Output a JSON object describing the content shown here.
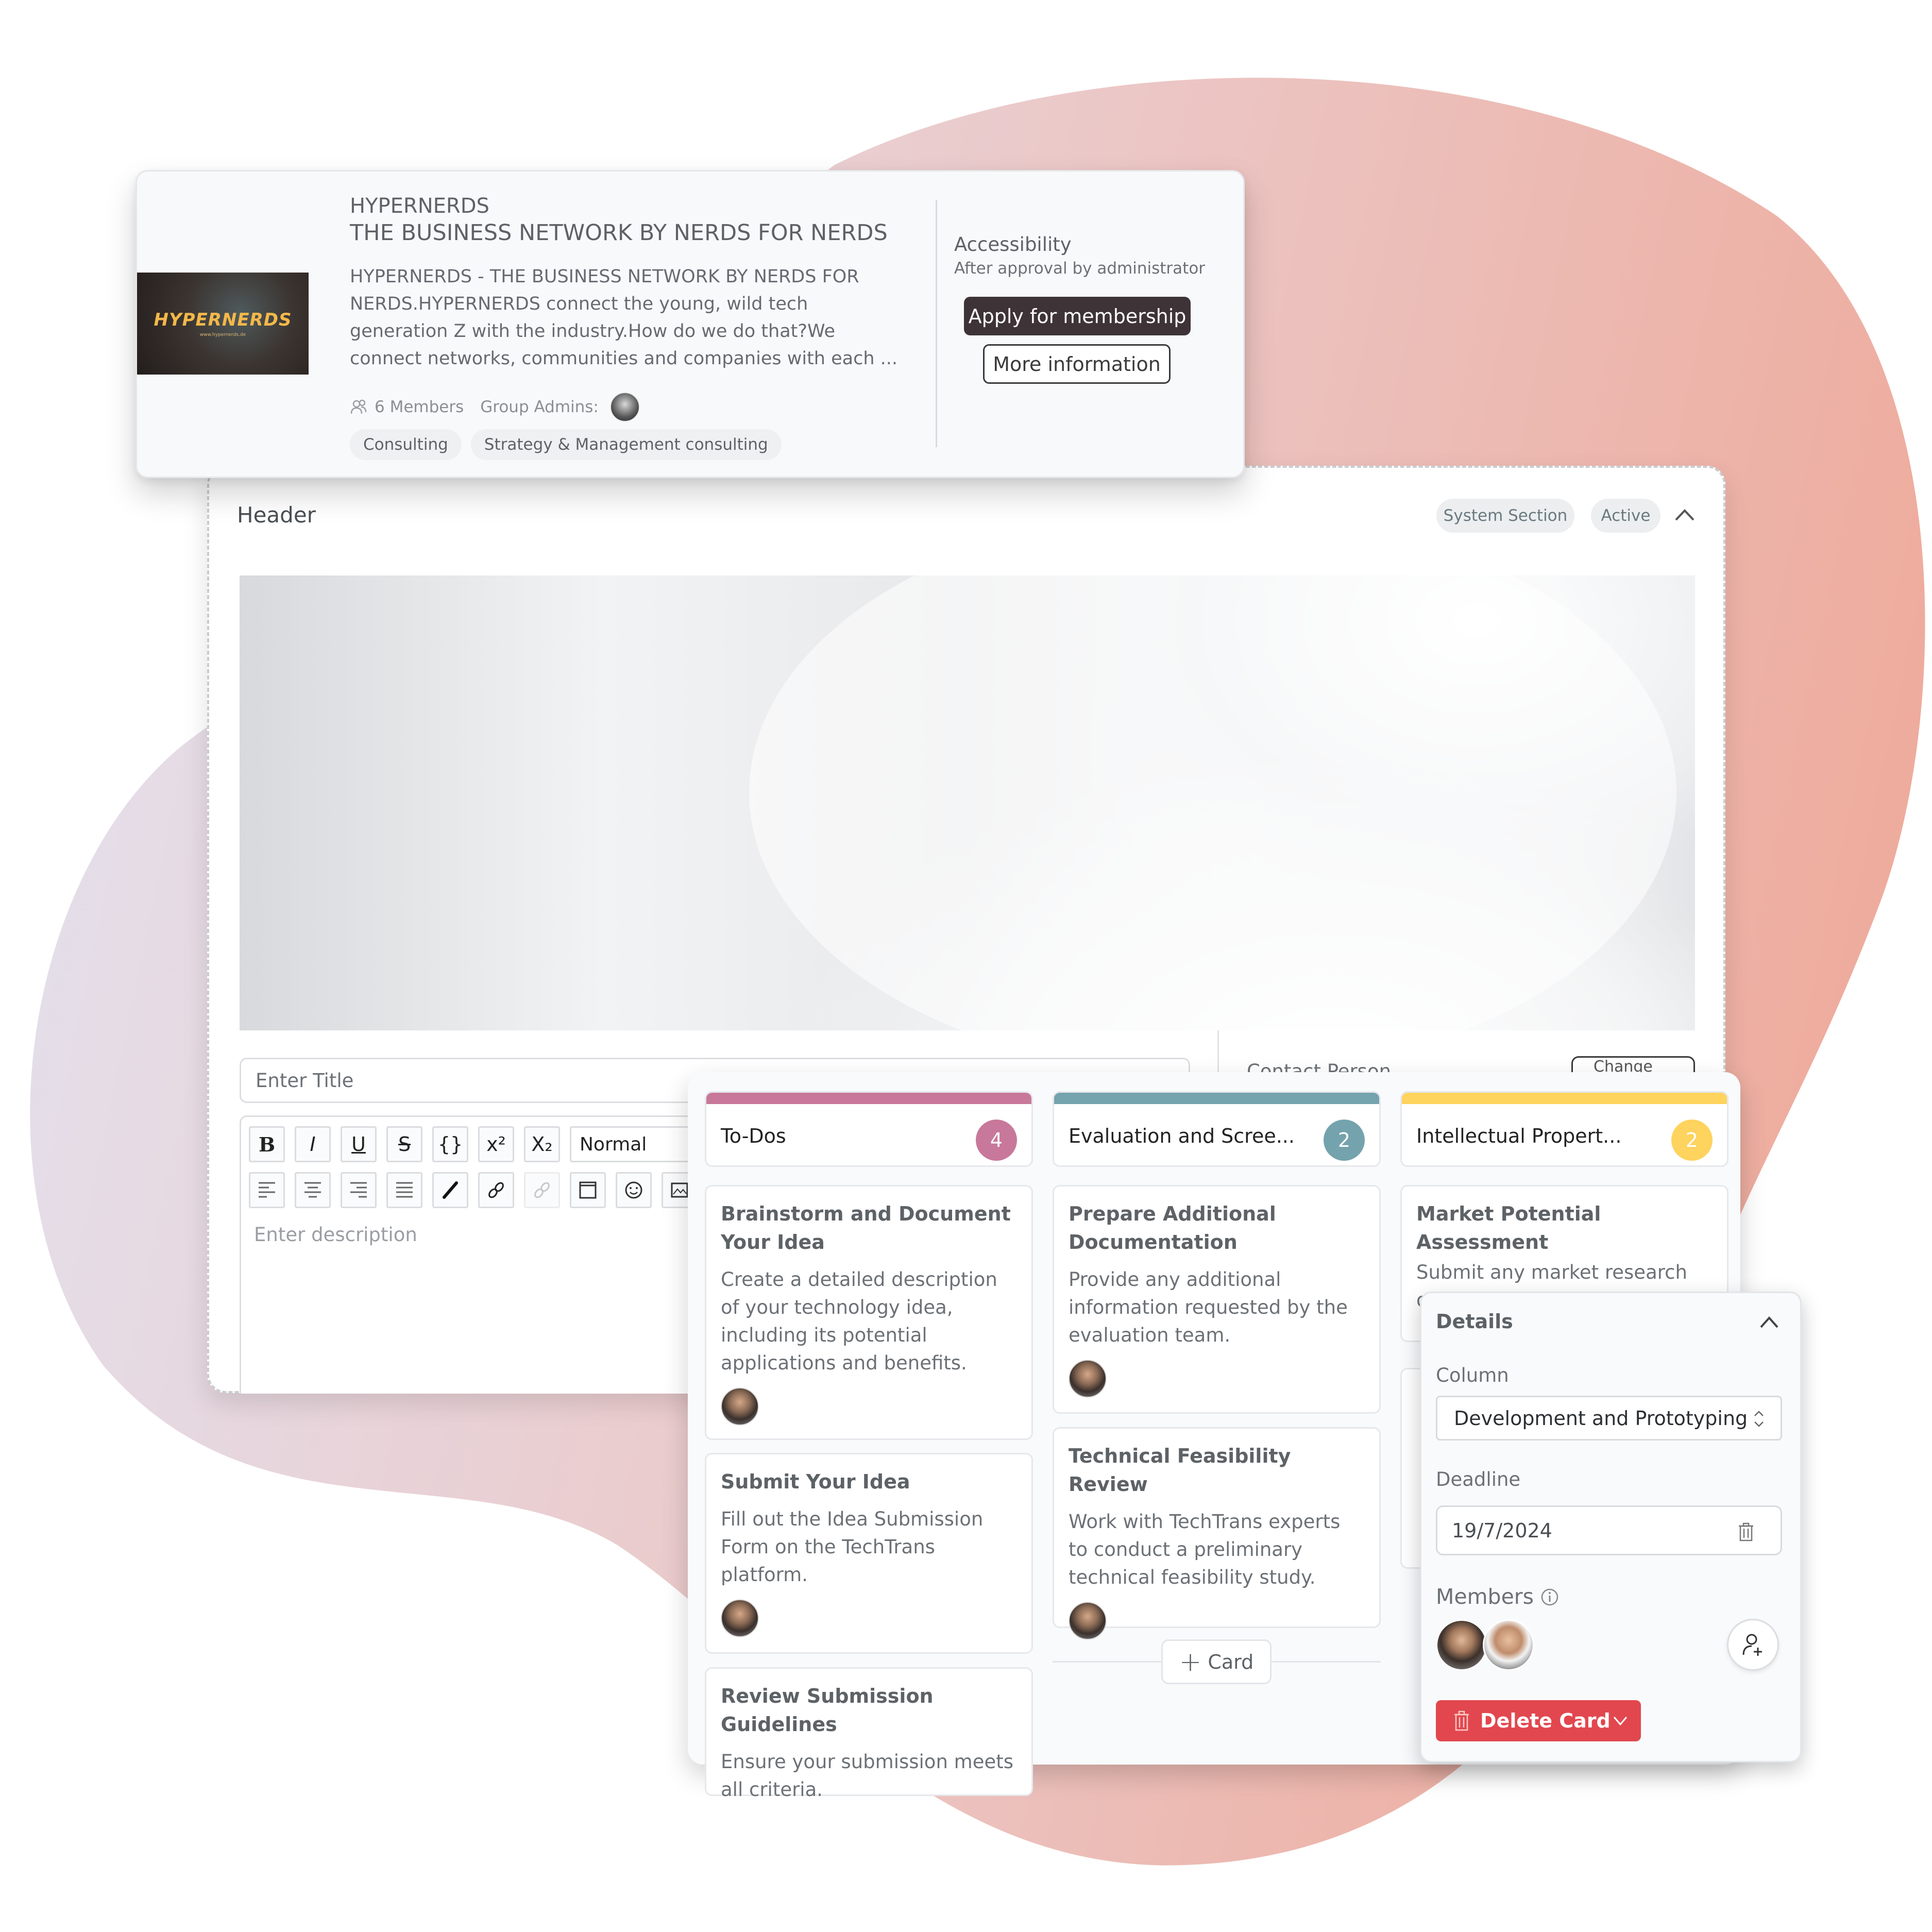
{
  "colors": {
    "blob_start": "#e6dde9",
    "blob_end": "#eeaea0",
    "todos": "#c8789a",
    "evaluation": "#74a3ad",
    "ip": "#fed35e",
    "danger": "#e2474f",
    "apply_bg": "#3e3337"
  },
  "group": {
    "logo_word": "HYPERNERDS",
    "logo_url": "www.hypernerds.de",
    "title_line1": "HYPERNERDS",
    "title_line2": "THE BUSINESS NETWORK BY NERDS FOR NERDS",
    "description": "HYPERNERDS - THE BUSINESS NETWORK BY NERDS FOR NERDS.HYPERNERDS connect the young, wild tech generation Z with the industry.How do we do that?We connect networks, communities and companies with each ...",
    "members": "6 Members",
    "admins_label": "Group Admins:",
    "tags": [
      "Consulting",
      "Strategy & Management consulting"
    ],
    "accessibility_title": "Accessibility",
    "accessibility_value": "After approval by administrator",
    "apply_label": "Apply for membership",
    "more_label": "More information"
  },
  "header_section": {
    "label": "Header",
    "badges": [
      "System Section",
      "Active"
    ],
    "title_placeholder": "Enter Title",
    "description_placeholder": "Enter description",
    "format_select": "Normal",
    "toolbar_row1": [
      {
        "name": "bold-button",
        "glyph": "B"
      },
      {
        "name": "italic-button",
        "glyph": "I"
      },
      {
        "name": "underline-button",
        "glyph": "U"
      },
      {
        "name": "strikethrough-button",
        "glyph": "S"
      },
      {
        "name": "code-button",
        "glyph": "{}"
      },
      {
        "name": "superscript-button",
        "glyph": "x²"
      },
      {
        "name": "subscript-button",
        "glyph": "X₂"
      }
    ],
    "toolbar_row2": [
      {
        "name": "align-left-button",
        "glyph": "≡"
      },
      {
        "name": "align-center-button",
        "glyph": "≡"
      },
      {
        "name": "align-right-button",
        "glyph": "≡"
      },
      {
        "name": "justify-button",
        "glyph": "≡"
      },
      {
        "name": "color-picker-button",
        "glyph": "✎"
      },
      {
        "name": "link-button",
        "glyph": "🔗"
      },
      {
        "name": "unlink-button",
        "glyph": "⛓"
      },
      {
        "name": "embed-button",
        "glyph": "▣"
      },
      {
        "name": "emoji-button",
        "glyph": "☺"
      },
      {
        "name": "image-button",
        "glyph": "▨"
      }
    ],
    "contact_label": "Contact Person",
    "contact_button": "Change"
  },
  "kanban": {
    "columns": [
      {
        "name": "To-Dos",
        "count": "4",
        "cards": [
          {
            "title": "Brainstorm and Document Your Idea",
            "desc": "Create a detailed description of your technology idea, including its potential applications and benefits."
          },
          {
            "title": "Submit Your Idea",
            "desc": "Fill out the Idea Submission Form on the TechTrans platform."
          },
          {
            "title": "Review Submission Guidelines",
            "desc": "Ensure your submission meets all criteria."
          }
        ]
      },
      {
        "name": "Evaluation and Scree...",
        "count": "2",
        "cards": [
          {
            "title": "Prepare Additional Documentation",
            "desc": "Provide any additional information requested by the evaluation team."
          },
          {
            "title": "Technical Feasibility Review",
            "desc": "Work with TechTrans experts to conduct a preliminary technical feasibility study."
          }
        ],
        "add_card_label": "Card"
      },
      {
        "name": "Intellectual Propert...",
        "count": "2",
        "cards": [
          {
            "title": "Market Potential Assessment",
            "desc": "Submit any market research or potential use cases."
          }
        ]
      }
    ]
  },
  "details": {
    "title": "Details",
    "column_label": "Column",
    "column_value": "Development and Prototyping",
    "deadline_label": "Deadline",
    "deadline_value": "19/7/2024",
    "members_label": "Members",
    "delete_label": "Delete Card"
  }
}
